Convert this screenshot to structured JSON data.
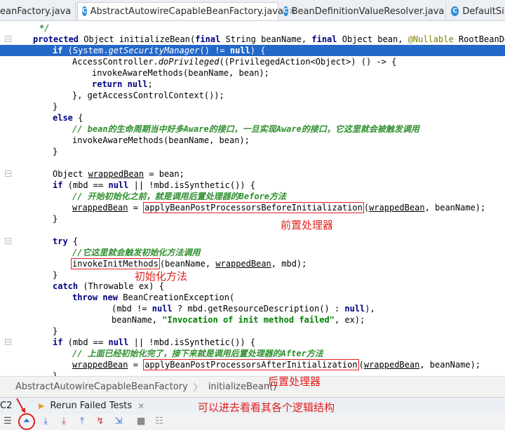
{
  "tabs": [
    {
      "label": "eanFactory.java",
      "active": false
    },
    {
      "label": "AbstractAutowireCapableBeanFactory.java",
      "active": true
    },
    {
      "label": "BeanDefinitionValueResolver.java",
      "active": false
    },
    {
      "label": "DefaultSin",
      "active": false
    }
  ],
  "code": {
    "l0": "*/",
    "l1_kw1": "protected",
    "l1_a": " Object initializeBean(",
    "l1_kw2": "final",
    "l1_b": " String beanName, ",
    "l1_kw3": "final",
    "l1_c": " Object bean, ",
    "l1_ann": "@Nullable",
    "l1_d": " RootBeanDefi",
    "l2_kw": "if",
    "l2_a": " (System.",
    "l2_it": "getSecurityManager",
    "l2_b": "() != ",
    "l2_null": "null",
    "l2_c": ") {",
    "l3_a": "AccessController.",
    "l3_it": "doPrivileged",
    "l3_b": "((PrivilegedAction<Object>) () -> {",
    "l4": "invokeAwareMethods(beanName, bean);",
    "l5_kw": "return",
    "l5_null": "null",
    "l5_end": ";",
    "l6": "}, getAccessControlContext());",
    "l7": "}",
    "l8_kw": "else",
    "l8_end": " {",
    "l9": "// bean的生命周期当中好多Aware的接口，一旦实现Aware的接口，它这里就会被触发调用",
    "l10": "invokeAwareMethods(beanName, bean);",
    "l11": "}",
    "l13_a": "Object ",
    "l13_ul": "wrappedBean",
    "l13_b": " = bean;",
    "l14_kw": "if",
    "l14_a": " (mbd == ",
    "l14_null": "null",
    "l14_b": " || !mbd.isSynthetic()) {",
    "l15": "// 开始初始化之前，就是调用后置处理器的Before方法",
    "l16_ul": "wrappedBean",
    "l16_eq": " = ",
    "l16_box": "applyBeanPostProcessorsBeforeInitialization",
    "l16_ul2": "wrappedBean",
    "l16_tail": ", beanName);",
    "l17": "}",
    "l19_kw": "try",
    "l19_end": " {",
    "l20": "//它这里就会触发初始化方法调用",
    "l21_box": "invokeInitMethods",
    "l21_a": "(beanName, ",
    "l21_ul": "wrappedBean",
    "l21_b": ", mbd);",
    "l22": "}",
    "l23_kw": "catch",
    "l23_a": " (Throwable ex) {",
    "l24_kw1": "throw",
    "l24_kw2": "new",
    "l24_a": " BeanCreationException(",
    "l25_a": "(mbd != ",
    "l25_null1": "null",
    "l25_b": " ? mbd.getResourceDescription() : ",
    "l25_null2": "null",
    "l25_c": "),",
    "l26_a": "beanName, ",
    "l26_str": "\"Invocation of init method failed\"",
    "l26_b": ", ex);",
    "l27": "}",
    "l28_kw": "if",
    "l28_a": " (mbd == ",
    "l28_null": "null",
    "l28_b": " || !mbd.isSynthetic()) {",
    "l29": "// 上面已经初始化完了，接下来就是调用后置处理器的After方法",
    "l30_ul": "wrappedBean",
    "l30_eq": " = ",
    "l30_box": "applyBeanPostProcessorsAfterInitialization",
    "l30_ul2": "wrappedBean",
    "l30_tail": ", beanName);",
    "l31": "}"
  },
  "annotations": {
    "before": "前置处理器",
    "init": "初始化方法",
    "after": "后置处理器",
    "tip": "可以进去看看其各个逻辑结构"
  },
  "breadcrumb": [
    "AbstractAutowireCapableBeanFactory",
    "initializeBean()"
  ],
  "run_panel": {
    "tab_left": "C2",
    "tab_label": "Rerun Failed Tests"
  },
  "colors": {
    "highlight": "#2468c8",
    "annotation": "#e02020",
    "comment": "#2f8f2f"
  }
}
